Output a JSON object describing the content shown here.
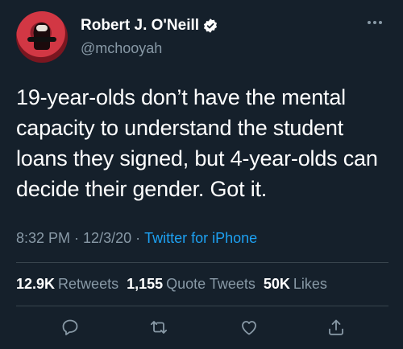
{
  "tweet": {
    "display_name": "Robert J. O'Neill",
    "handle": "@mchooyah",
    "text": "19-year-olds don’t have the mental capacity to understand the student loans they signed, but 4-year-olds can decide their gender. Got it.",
    "time": "8:32 PM",
    "separator": " · ",
    "date": "12/3/20",
    "source": "Twitter for iPhone"
  },
  "stats": [
    {
      "count": "12.9K",
      "label": "Retweets"
    },
    {
      "count": "1,155",
      "label": "Quote Tweets"
    },
    {
      "count": "50K",
      "label": "Likes"
    }
  ],
  "icons": {
    "verified": "verified-badge-icon",
    "more": "more-dots-icon",
    "reply": "reply-icon",
    "retweet": "retweet-icon",
    "like": "heart-icon",
    "share": "share-icon"
  },
  "colors": {
    "background": "#15202b",
    "secondary_text": "#8899a6",
    "accent": "#1da1f2"
  }
}
